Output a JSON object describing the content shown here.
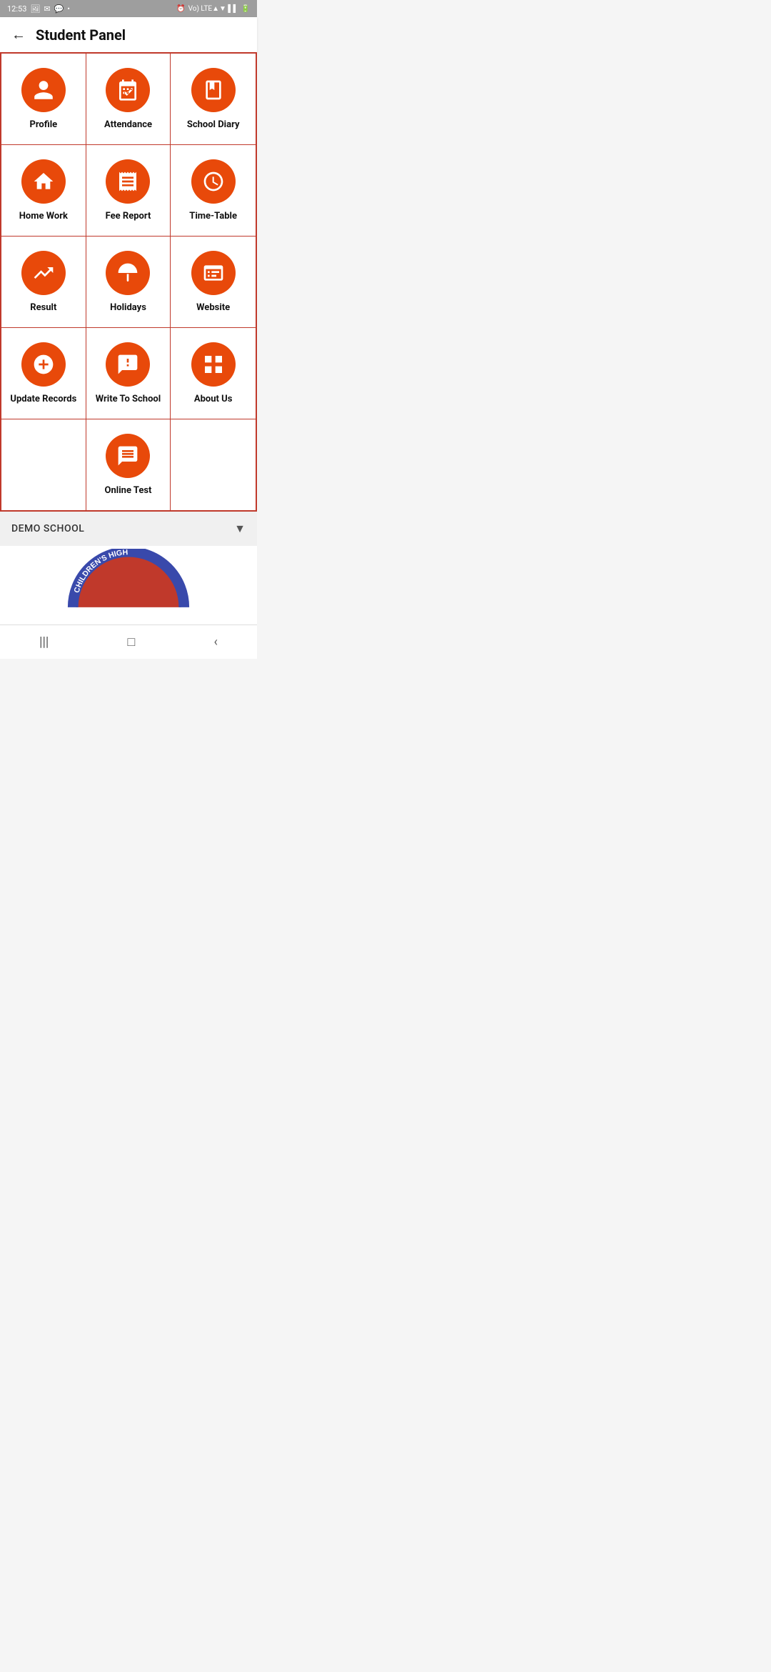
{
  "statusBar": {
    "time": "12:53",
    "rightIcons": "Vo) LTE ▲▼"
  },
  "appBar": {
    "backLabel": "←",
    "title": "Student Panel"
  },
  "grid": {
    "rows": [
      [
        {
          "id": "profile",
          "label": "Profile",
          "icon": "person"
        },
        {
          "id": "attendance",
          "label": "Attendance",
          "icon": "calendar-check"
        },
        {
          "id": "school-diary",
          "label": "School Diary",
          "icon": "book"
        }
      ],
      [
        {
          "id": "home-work",
          "label": "Home Work",
          "icon": "home"
        },
        {
          "id": "fee-report",
          "label": "Fee Report",
          "icon": "receipt"
        },
        {
          "id": "time-table",
          "label": "Time-Table",
          "icon": "clock"
        }
      ],
      [
        {
          "id": "result",
          "label": "Result",
          "icon": "trending-up"
        },
        {
          "id": "holidays",
          "label": "Holidays",
          "icon": "umbrella"
        },
        {
          "id": "website",
          "label": "Website",
          "icon": "browser"
        }
      ],
      [
        {
          "id": "update-records",
          "label": "Update Records",
          "icon": "add-circle"
        },
        {
          "id": "write-to-school",
          "label": "Write To School",
          "icon": "message-alert"
        },
        {
          "id": "about-us",
          "label": "About Us",
          "icon": "grid"
        }
      ],
      [
        {
          "id": "empty-1",
          "label": "",
          "icon": ""
        },
        {
          "id": "online-test",
          "label": "Online Test",
          "icon": "chat"
        },
        {
          "id": "empty-2",
          "label": "",
          "icon": ""
        }
      ]
    ]
  },
  "schoolSelector": {
    "name": "DEMO SCHOOL",
    "dropdownIcon": "▼"
  },
  "navBar": {
    "items": [
      "|||",
      "□",
      "<"
    ]
  }
}
